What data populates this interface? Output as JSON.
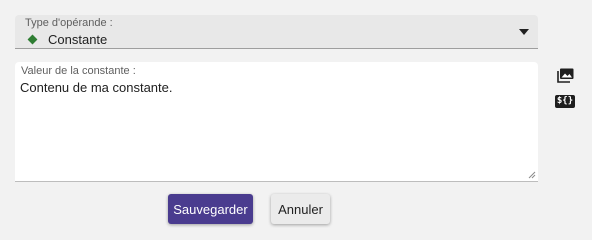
{
  "operand_select": {
    "label": "Type d'opérande :",
    "value": "Constante",
    "value_icon": "green-diamond-icon",
    "icon_color": "#2e7d32"
  },
  "constant_field": {
    "label": "Valeur de la constante :",
    "value": "Contenu de ma constante."
  },
  "side_icons": {
    "image": "image-icon",
    "variable": "${}"
  },
  "buttons": {
    "save_label": "Sauvegarder",
    "cancel_label": "Annuler",
    "save_color": "#4a3c8f"
  }
}
